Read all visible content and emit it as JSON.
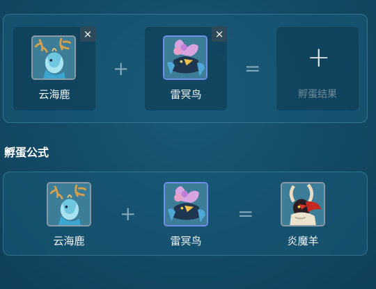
{
  "breeding": {
    "parent1": {
      "name": "云海鹿",
      "remove_icon": "×"
    },
    "plus_symbol": "+",
    "parent2": {
      "name": "雷冥鸟",
      "remove_icon": "×"
    },
    "equals_symbol": "=",
    "result": {
      "add_icon": "+",
      "label": "孵蛋结果"
    }
  },
  "formula": {
    "title": "孵蛋公式",
    "parent1_name": "云海鹿",
    "plus_symbol": "+",
    "parent2_name": "雷冥鸟",
    "equals_symbol": "=",
    "result_name": "炎魔羊"
  },
  "colors": {
    "background": "#134a66",
    "panel_border": "#5f9fbd",
    "rare_border": "#6f8fe8",
    "normal_border": "#8a9aa6"
  }
}
